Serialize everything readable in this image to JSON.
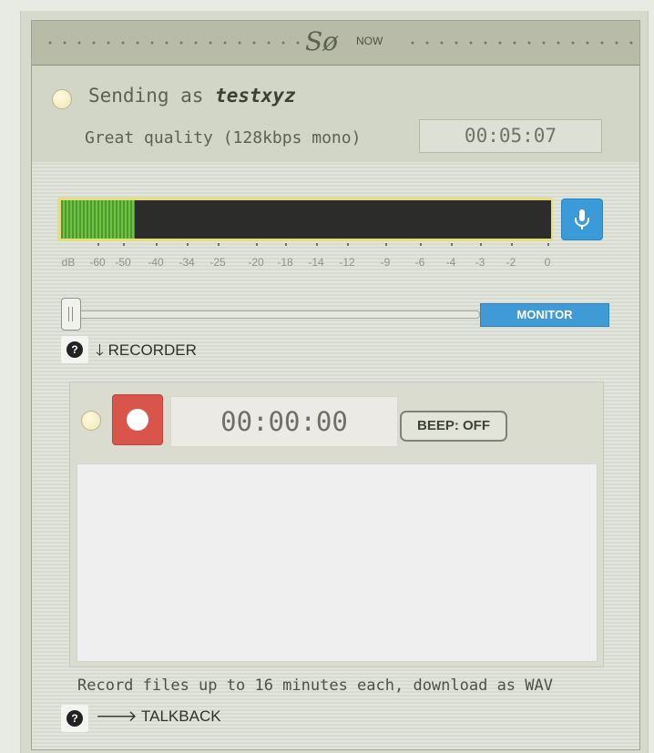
{
  "header": {
    "logo_text": "Sø",
    "logo_small": "NOW"
  },
  "sending": {
    "prefix": "Sending as",
    "username": "testxyz",
    "quality": "Great quality (128kbps mono)",
    "elapsed": "00:05:07"
  },
  "meter": {
    "level_fraction": 0.15,
    "labels": [
      "dB",
      "-60",
      "-50",
      "-40",
      "-34",
      "-25",
      "-20",
      "-18",
      "-14",
      "-12",
      "-9",
      "-6",
      "-4",
      "-3",
      "-2",
      "0"
    ],
    "fill_color": "#5fb33a",
    "frame_color": "#e4df7a"
  },
  "monitor": {
    "button_label": "MONITOR",
    "slider_value": 0
  },
  "recorder_section": {
    "toggle_arrow": "🡓",
    "label": "RECORDER"
  },
  "recorder": {
    "timer": "00:00:00",
    "beep_label": "BEEP: OFF",
    "note": "Record files up to 16 minutes each, download as WAV"
  },
  "talkback_section": {
    "toggle_arrow": "🡒",
    "label": "TALKBACK"
  },
  "help_glyph": "?",
  "colors": {
    "accent_blue": "#3b9bd9",
    "record_red": "#d9544a",
    "status_dot": "#f4eec4"
  }
}
